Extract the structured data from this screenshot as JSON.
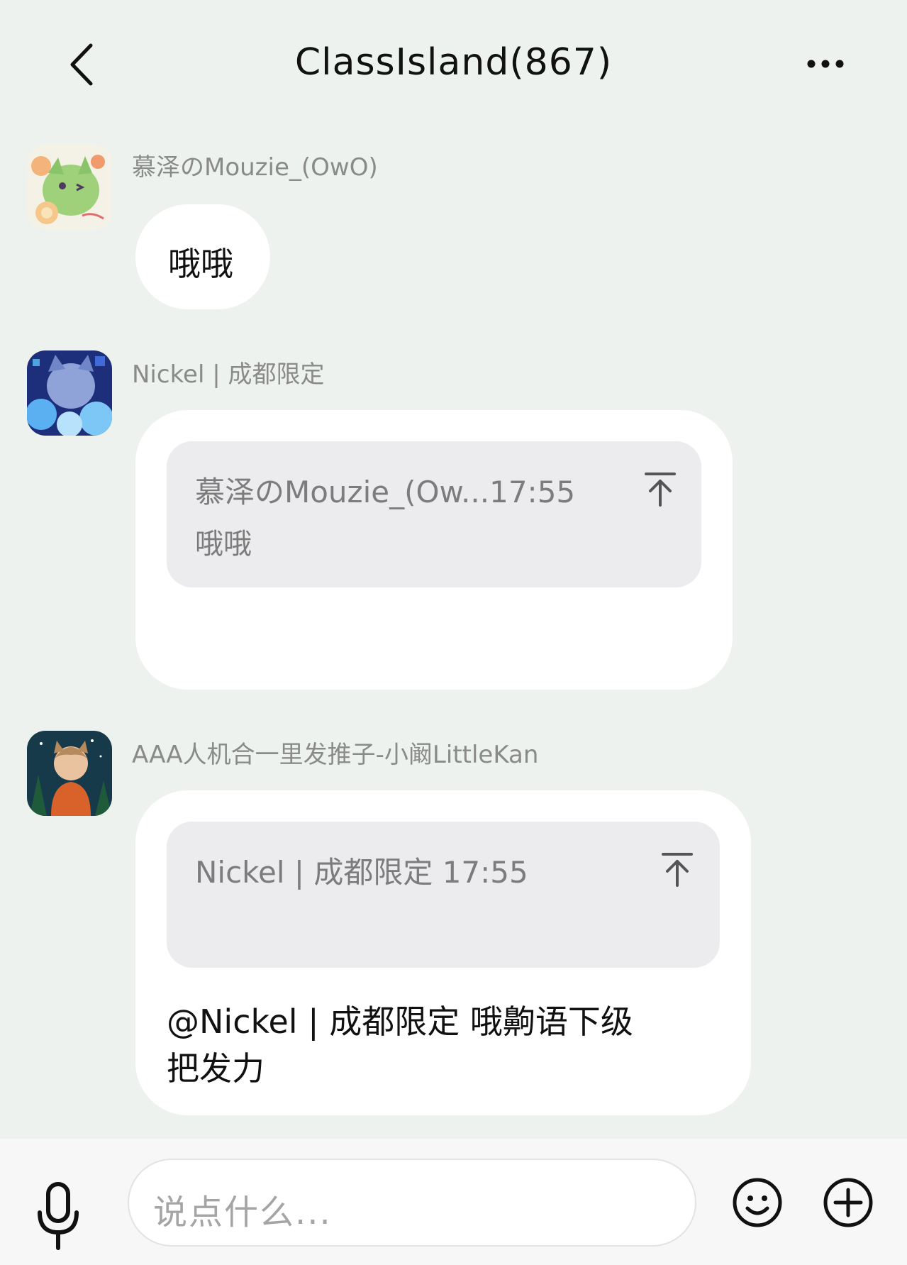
{
  "header": {
    "title": "ClassIsland(867)",
    "back_icon": "chevron-left-icon",
    "more_icon": "more-dots-icon"
  },
  "messages": [
    {
      "sender": "慕泽のMouzie_(OwO)",
      "text": "哦哦"
    },
    {
      "sender": "Nickel | 成都限定",
      "quote": {
        "meta": "慕泽のMouzie_(Ow...17:55",
        "text": "哦哦"
      },
      "text": ""
    },
    {
      "sender": "AAA人机合一里发推子-小阚LittleKan",
      "quote": {
        "meta": "Nickel | 成都限定 17:55",
        "text": ""
      },
      "text_line1": "@Nickel | 成都限定 哦齁语下级",
      "text_line2": "把发力"
    }
  ],
  "input": {
    "placeholder": "说点什么..."
  },
  "icons": {
    "mic": "microphone-icon",
    "emoji": "emoji-icon",
    "plus": "plus-circle-icon"
  },
  "colors": {
    "background": "#eef2ef",
    "bubble": "#ffffff",
    "quote": "#ecebed",
    "secondary_text": "#8a8a8a"
  }
}
